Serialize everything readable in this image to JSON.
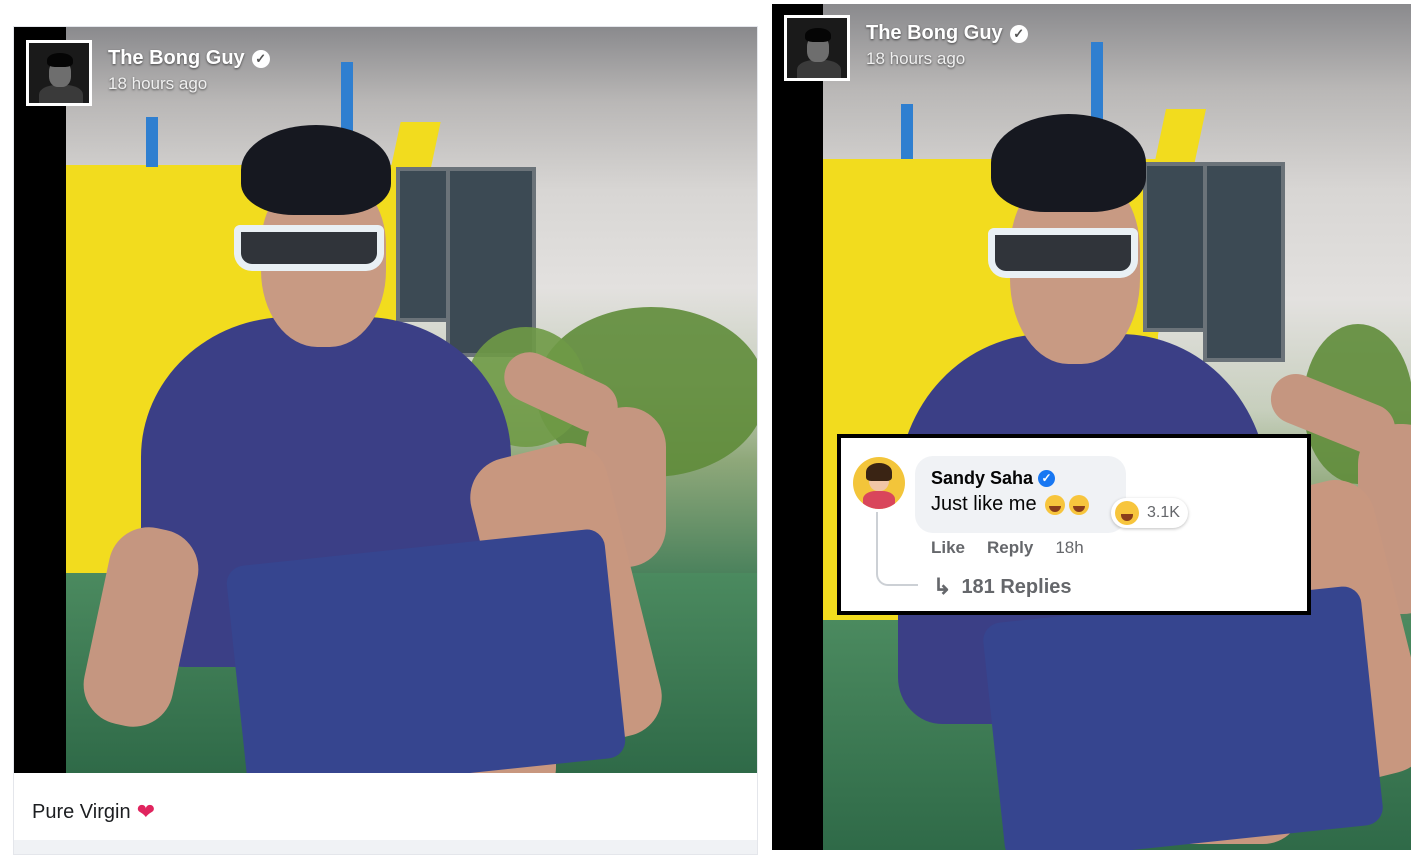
{
  "post": {
    "author_name": "The Bong Guy",
    "timestamp": "18 hours ago",
    "caption": "Pure Virgin",
    "caption_emoji": "❤",
    "verified_icon": "verified-badge-icon"
  },
  "comment": {
    "author_name": "Sandy Saha",
    "text": "Just like me",
    "reaction_count": "3.1K",
    "like_label": "Like",
    "reply_label": "Reply",
    "time": "18h",
    "replies_label": "181 Replies",
    "reply_arrow": "↳"
  },
  "colors": {
    "facebook_blue": "#1877f2",
    "bubble_gray": "#f0f2f5",
    "meta_text": "#65676b"
  }
}
